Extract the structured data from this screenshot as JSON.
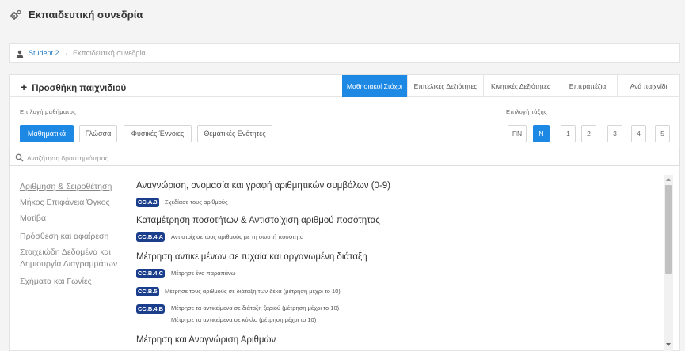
{
  "header": {
    "title": "Εκπαιδευτική συνεδρία"
  },
  "breadcrumb": {
    "student": "Student 2",
    "separator": "/",
    "current": "Εκπαιδευτική συνεδρία"
  },
  "panel": {
    "add_game": "Προσθήκη παιχνιδιού",
    "category_tabs": [
      "Μαθησιακοί Στόχοι",
      "Επιτελικές Δεξιότητες",
      "Κινητικές Δεξιότητες",
      "Επιτραπέζια",
      "Ανά παιχνίδι"
    ],
    "active_category": "Μαθησιακοί Στόχοι"
  },
  "subject": {
    "label": "Επιλογή μαθήματος",
    "options": [
      "Μαθηματικά",
      "Γλώσσα",
      "Φυσικές Έννοιες",
      "Θεματικές Ενότητες"
    ],
    "selected": "Μαθηματικά"
  },
  "grade": {
    "label": "Επιλογή τάξης",
    "options": [
      "ΠΝ",
      "N",
      "1",
      "2",
      "3",
      "4",
      "5"
    ],
    "selected": "N"
  },
  "search": {
    "placeholder": "Αναζήτηση δραστηριότητας",
    "value": ""
  },
  "sidebar": {
    "items": [
      "Αριθμηση & Σειροθέτηση",
      "Μήκος Επιφάνεια Όγκος",
      "Μοτίβα",
      "Πρόσθεση και αφαίρεση",
      "Στοιχειώδη Δεδομένα και",
      "Δημιουργία Διαγραμμάτων",
      "Σχήματα και Γωνίες"
    ]
  },
  "content": {
    "sections": [
      {
        "title": "Αναγνώριση, ονομασία και γραφή αριθμητικών συμβόλων (0-9)",
        "items": [
          {
            "code": "CC.A.3",
            "desc": "Σχεδίασε τους αριθμούς"
          }
        ]
      },
      {
        "title": "Καταμέτρηση ποσοτήτων & Αντιστοίχιση αριθμού ποσότητας",
        "items": [
          {
            "code": "CC.B.4.A",
            "desc": "Αντιστοίχισε τους αριθμούς με τη σωστή ποσότητα"
          }
        ]
      },
      {
        "title": "Μέτρηση αντικειμένων σε τυχαία και οργανωμένη διάταξη",
        "items": [
          {
            "code": "CC.B.4.C",
            "desc": "Μέτρησε ένα παραπάνω"
          },
          {
            "code": "CC.B.5",
            "desc": "Μέτρησε τους αριθμούς σε διάταξη των δέκα (μέτρηση μέχρι το 10)"
          },
          {
            "code": "CC.B.4.B",
            "desc": "Μέτρησε τα αντικείμενα σε διάταξη ζαριού (μέτρηση μέχρι το 10)",
            "desc2": "Μέτρησε τα αντικείμενα σε κύκλο (μέτρηση μέχρι το 10)"
          }
        ]
      },
      {
        "title": "Μέτρηση και Αναγνώριση Αριθμών",
        "items": []
      }
    ]
  },
  "colors": {
    "accent": "#1e88e5",
    "code_badge": "#1a3e8c",
    "link": "#2a7ec6"
  }
}
